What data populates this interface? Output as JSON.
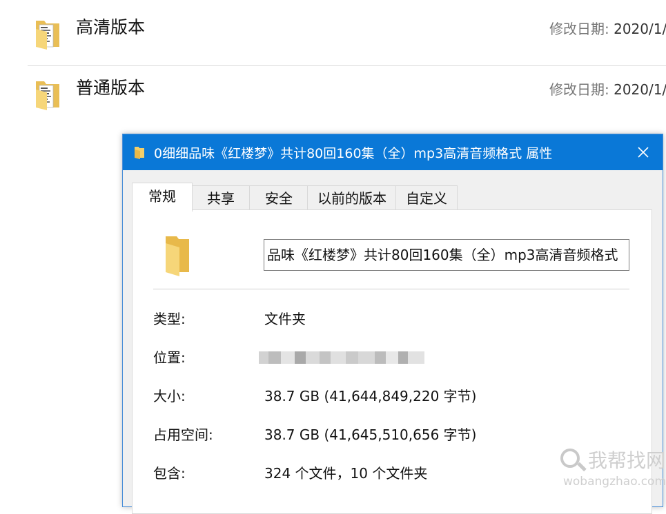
{
  "explorer": {
    "rows": [
      {
        "name": "高清版本",
        "date_label": "修改日期:",
        "date_value": "2020/1/"
      },
      {
        "name": "普通版本",
        "date_label": "修改日期:",
        "date_value": "2020/1/"
      }
    ]
  },
  "dialog": {
    "title": "0细细品味《红楼梦》共计80回160集（全）mp3高清音频格式 属性",
    "tabs": [
      "常规",
      "共享",
      "安全",
      "以前的版本",
      "自定义"
    ],
    "active_tab": "常规",
    "name_value": "品味《红楼梦》共计80回160集（全）mp3高清音频格式",
    "properties": {
      "type": {
        "label": "类型:",
        "value": "文件夹"
      },
      "location": {
        "label": "位置:",
        "value": ""
      },
      "size": {
        "label": "大小:",
        "value": "38.7 GB (41,644,849,220 字节)"
      },
      "on_disk": {
        "label": "占用空间:",
        "value": "38.7 GB (41,645,510,656 字节)"
      },
      "contains": {
        "label": "包含:",
        "value": "324 个文件，10 个文件夹"
      }
    }
  },
  "watermark": {
    "text": "我帮找网",
    "url": "wobangzhao.com"
  },
  "colors": {
    "titlebar": "#0a78d7",
    "folder": "#f3cf6a"
  },
  "icons": [
    "folder-icon",
    "close-icon",
    "search-icon"
  ]
}
